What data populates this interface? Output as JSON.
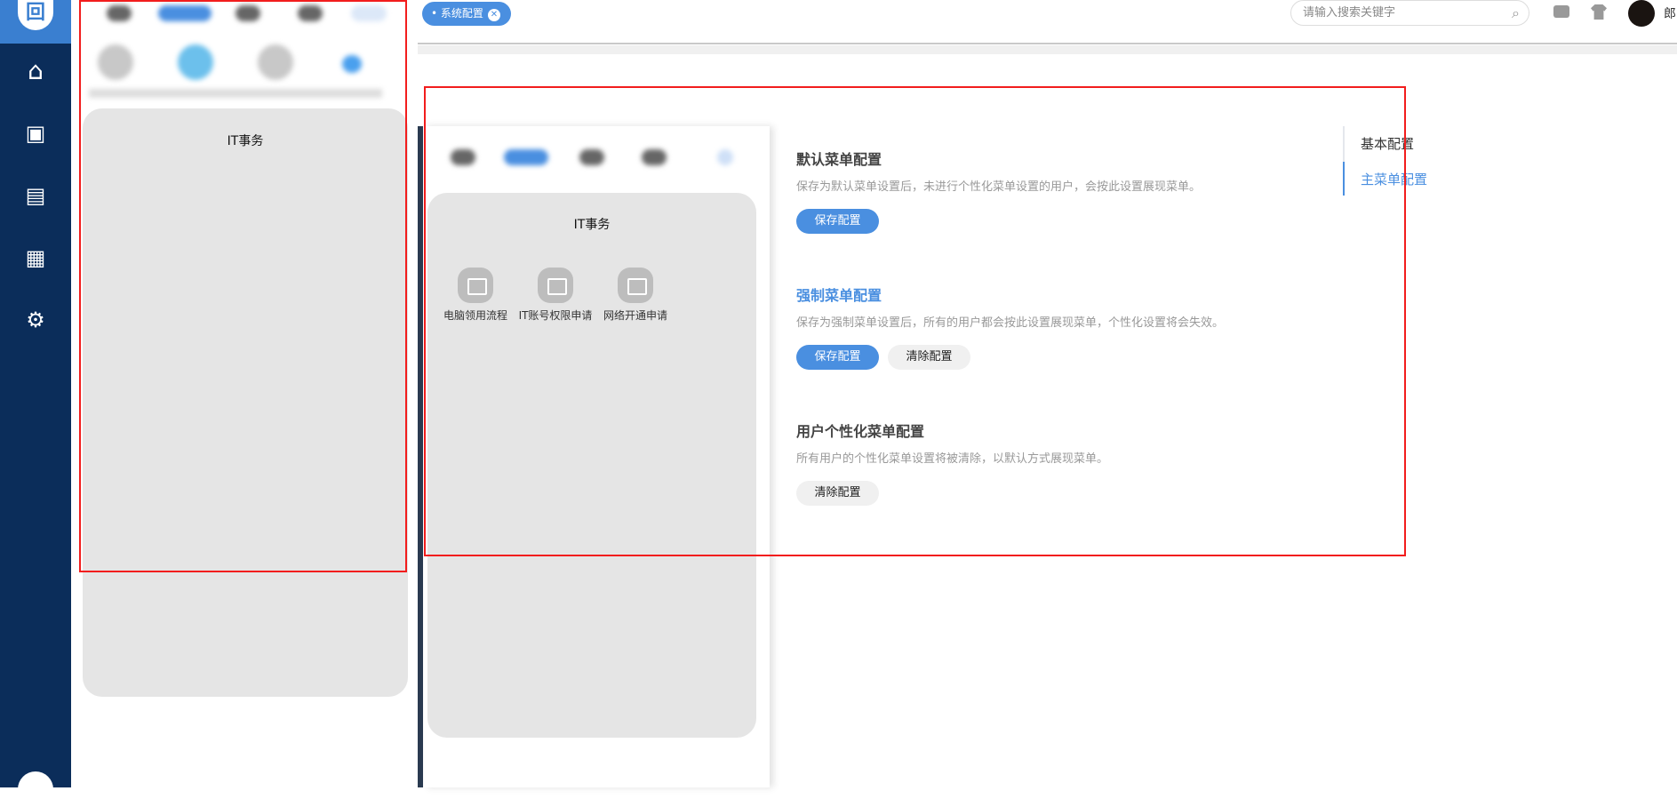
{
  "topbar": {
    "tab_label": "系统配置",
    "search_placeholder": "请输入搜索关键字",
    "user_name": "郎"
  },
  "sidebar": {
    "items": [
      "home",
      "monitor-user",
      "news",
      "calendar",
      "user-settings"
    ]
  },
  "preview": {
    "group_title": "IT事务",
    "apps": [
      "电脑领用流程",
      "IT账号权限申请",
      "网络开通申请"
    ]
  },
  "sections": [
    {
      "title": "默认菜单配置",
      "desc": "保存为默认菜单设置后，未进行个性化菜单设置的用户，会按此设置展现菜单。",
      "buttons": [
        "保存配置"
      ]
    },
    {
      "title": "强制菜单配置",
      "desc": "保存为强制菜单设置后，所有的用户都会按此设置展现菜单，个性化设置将会失效。",
      "buttons": [
        "保存配置",
        "清除配置"
      ]
    },
    {
      "title": "用户个性化菜单配置",
      "desc": "所有用户的个性化菜单设置将被清除，以默认方式展现菜单。",
      "buttons": [
        "清除配置"
      ]
    }
  ],
  "right_nav": {
    "items": [
      "基本配置",
      "主菜单配置"
    ]
  },
  "colors": {
    "accent": "#4a8fe0",
    "sidebar": "#0b2d5a",
    "highlight": "#f21d1d"
  }
}
